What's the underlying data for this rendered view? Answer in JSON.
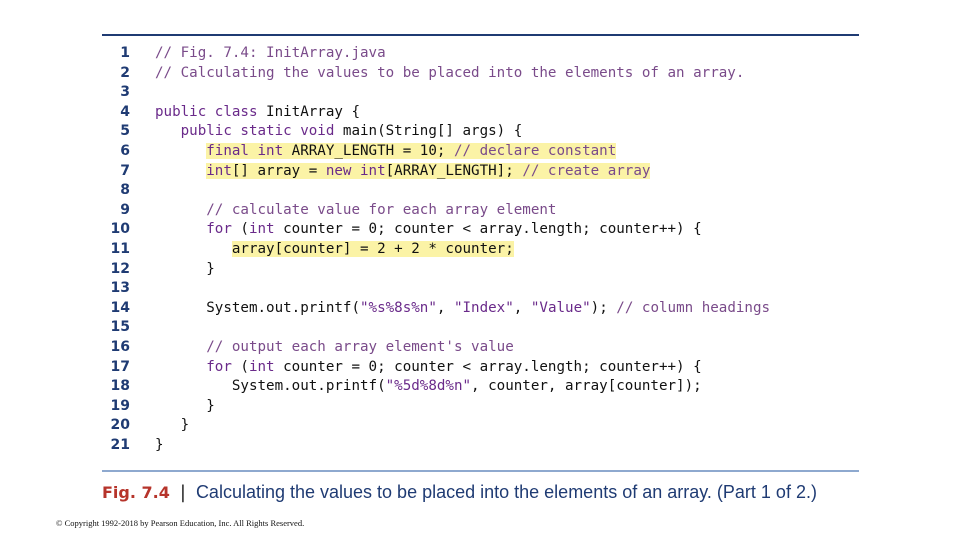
{
  "code_listing": {
    "lines": [
      {
        "num": "1",
        "segs": [
          {
            "t": "// Fig. 7.4: InitArray.java",
            "c": "c"
          }
        ]
      },
      {
        "num": "2",
        "segs": [
          {
            "t": "// Calculating the values to be placed into the elements of an array.",
            "c": "c"
          }
        ]
      },
      {
        "num": "3",
        "segs": []
      },
      {
        "num": "4",
        "segs": [
          {
            "t": "public class ",
            "c": "k"
          },
          {
            "t": "InitArray {",
            "c": "p"
          }
        ]
      },
      {
        "num": "5",
        "segs": [
          {
            "t": "   public static void ",
            "c": "k"
          },
          {
            "t": "main(String[] args) {",
            "c": "p"
          }
        ]
      },
      {
        "num": "6",
        "highlight": true,
        "segs": [
          {
            "t": "      "
          },
          {
            "t": "final int ",
            "c": "k",
            "h": true
          },
          {
            "t": "ARRAY_LENGTH = 10; ",
            "c": "p",
            "h": true
          },
          {
            "t": "// declare constant",
            "c": "c",
            "h": true
          }
        ]
      },
      {
        "num": "7",
        "highlight": true,
        "segs": [
          {
            "t": "      "
          },
          {
            "t": "int",
            "c": "k",
            "h": true
          },
          {
            "t": "[] array = ",
            "c": "p",
            "h": true
          },
          {
            "t": "new int",
            "c": "k",
            "h": true
          },
          {
            "t": "[ARRAY_LENGTH]; ",
            "c": "p",
            "h": true
          },
          {
            "t": "// create array",
            "c": "c",
            "h": true
          }
        ]
      },
      {
        "num": "8",
        "segs": []
      },
      {
        "num": "9",
        "segs": [
          {
            "t": "      // calculate value for each array element",
            "c": "c"
          }
        ]
      },
      {
        "num": "10",
        "segs": [
          {
            "t": "      "
          },
          {
            "t": "for ",
            "c": "k"
          },
          {
            "t": "(",
            "c": "p"
          },
          {
            "t": "int ",
            "c": "k"
          },
          {
            "t": "counter = 0; counter < array.length; counter++) {",
            "c": "p"
          }
        ]
      },
      {
        "num": "11",
        "segs": [
          {
            "t": "         "
          },
          {
            "t": "array[counter] = 2 + 2 * counter;",
            "c": "p",
            "h": true
          }
        ]
      },
      {
        "num": "12",
        "segs": [
          {
            "t": "      }",
            "c": "p"
          }
        ]
      },
      {
        "num": "13",
        "segs": []
      },
      {
        "num": "14",
        "segs": [
          {
            "t": "      System.out.printf(",
            "c": "p"
          },
          {
            "t": "\"%s%8s%n\"",
            "c": "s"
          },
          {
            "t": ", ",
            "c": "p"
          },
          {
            "t": "\"Index\"",
            "c": "s"
          },
          {
            "t": ", ",
            "c": "p"
          },
          {
            "t": "\"Value\"",
            "c": "s"
          },
          {
            "t": "); ",
            "c": "p"
          },
          {
            "t": "// column headings",
            "c": "c"
          }
        ]
      },
      {
        "num": "15",
        "segs": []
      },
      {
        "num": "16",
        "segs": [
          {
            "t": "      // output each array element's value",
            "c": "c"
          }
        ]
      },
      {
        "num": "17",
        "segs": [
          {
            "t": "      "
          },
          {
            "t": "for ",
            "c": "k"
          },
          {
            "t": "(",
            "c": "p"
          },
          {
            "t": "int ",
            "c": "k"
          },
          {
            "t": "counter = 0; counter < array.length; counter++) {",
            "c": "p"
          }
        ]
      },
      {
        "num": "18",
        "segs": [
          {
            "t": "         System.out.printf(",
            "c": "p"
          },
          {
            "t": "\"%5d%8d%n\"",
            "c": "s"
          },
          {
            "t": ", counter, array[counter]);",
            "c": "p"
          }
        ]
      },
      {
        "num": "19",
        "segs": [
          {
            "t": "      }",
            "c": "p"
          }
        ]
      },
      {
        "num": "20",
        "segs": [
          {
            "t": "   }",
            "c": "p"
          }
        ]
      },
      {
        "num": "21",
        "segs": [
          {
            "t": "}",
            "c": "p"
          }
        ]
      }
    ]
  },
  "caption": {
    "label": "Fig. 7.4",
    "separator": "|",
    "text": "Calculating the values to be placed into the elements of an array. (Part 1 of 2.)"
  },
  "copyright": "© Copyright 1992-2018 by Pearson Education, Inc. All Rights Reserved.",
  "colors": {
    "highlight": "#fbf3a6",
    "rule_top": "#1f3b73",
    "rule_bottom": "#8ea9cf",
    "fig_label": "#b6342b"
  }
}
